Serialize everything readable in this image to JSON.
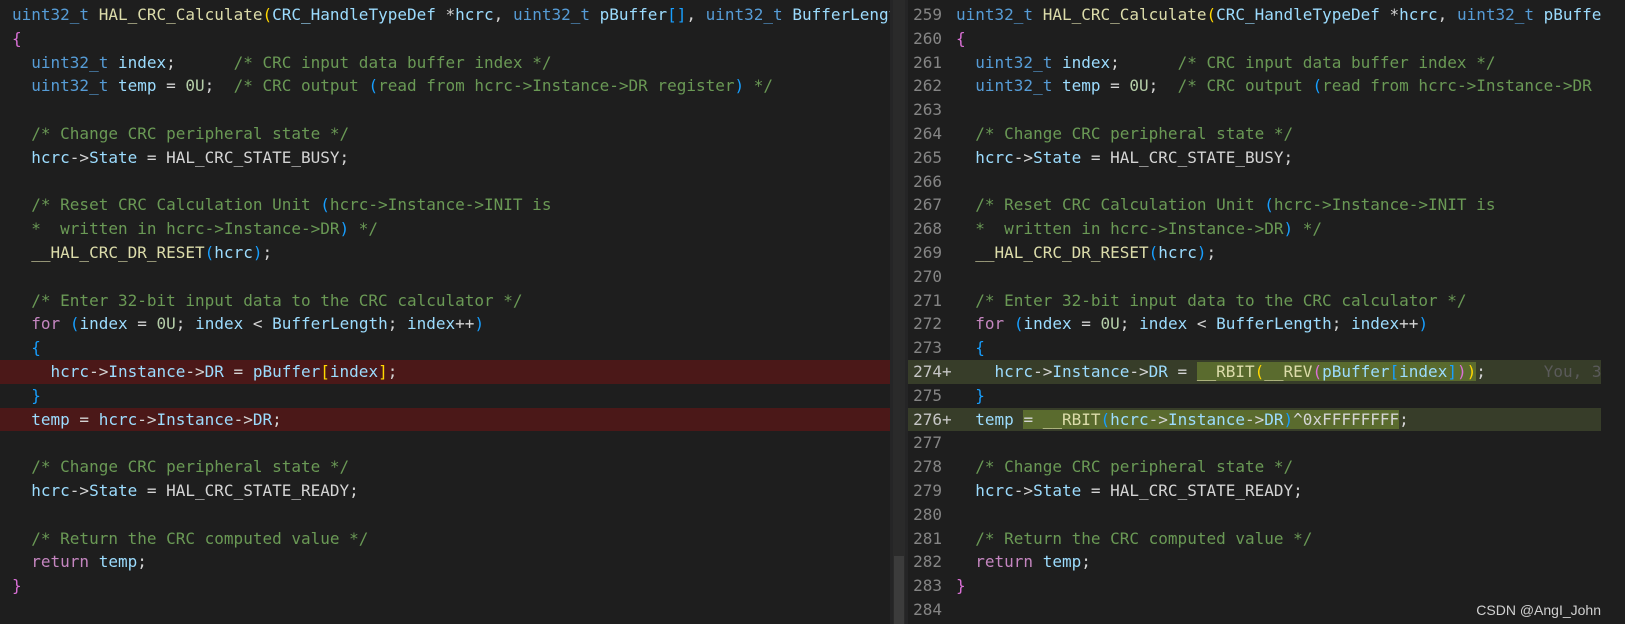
{
  "editor": {
    "watermark": "CSDN @AngI_John",
    "blame_hint": "You, 3"
  },
  "left": {
    "lines": [
      {
        "kind": "normal",
        "tokens": [
          [
            "type",
            "uint32_t"
          ],
          [
            "txt",
            " "
          ],
          [
            "fn",
            "HAL_CRC_Calculate"
          ],
          [
            "br3",
            "("
          ],
          [
            "id",
            "CRC_HandleTypeDef"
          ],
          [
            "txt",
            " *"
          ],
          [
            "id",
            "hcrc"
          ],
          [
            "txt",
            ", "
          ],
          [
            "type",
            "uint32_t"
          ],
          [
            "txt",
            " "
          ],
          [
            "id",
            "pBuffer"
          ],
          [
            "br2",
            "[]"
          ],
          [
            "txt",
            ", "
          ],
          [
            "type",
            "uint32_t"
          ],
          [
            "txt",
            " "
          ],
          [
            "id",
            "BufferLength"
          ]
        ]
      },
      {
        "kind": "normal",
        "tokens": [
          [
            "br1",
            "{"
          ]
        ]
      },
      {
        "kind": "normal",
        "tokens": [
          [
            "txt",
            "  "
          ],
          [
            "type",
            "uint32_t"
          ],
          [
            "txt",
            " "
          ],
          [
            "id",
            "index"
          ],
          [
            "txt",
            ";      "
          ],
          [
            "cm",
            "/* CRC input data buffer index */"
          ]
        ]
      },
      {
        "kind": "normal",
        "tokens": [
          [
            "txt",
            "  "
          ],
          [
            "type",
            "uint32_t"
          ],
          [
            "txt",
            " "
          ],
          [
            "id",
            "temp"
          ],
          [
            "txt",
            " = "
          ],
          [
            "num",
            "0U"
          ],
          [
            "txt",
            ";  "
          ],
          [
            "cm",
            "/* CRC output "
          ],
          [
            "br2",
            "("
          ],
          [
            "cm",
            "read from hcrc->Instance->DR register"
          ],
          [
            "br2",
            ")"
          ],
          [
            "cm",
            " */"
          ]
        ]
      },
      {
        "kind": "normal",
        "tokens": []
      },
      {
        "kind": "normal",
        "tokens": [
          [
            "txt",
            "  "
          ],
          [
            "cm",
            "/* Change CRC peripheral state */"
          ]
        ]
      },
      {
        "kind": "normal",
        "tokens": [
          [
            "txt",
            "  "
          ],
          [
            "id",
            "hcrc"
          ],
          [
            "txt",
            "->"
          ],
          [
            "id",
            "State"
          ],
          [
            "txt",
            " = HAL_CRC_STATE_BUSY;"
          ]
        ]
      },
      {
        "kind": "normal",
        "tokens": []
      },
      {
        "kind": "normal",
        "tokens": [
          [
            "txt",
            "  "
          ],
          [
            "cm",
            "/* Reset CRC Calculation Unit "
          ],
          [
            "br2",
            "("
          ],
          [
            "cm",
            "hcrc->Instance->INIT is"
          ]
        ]
      },
      {
        "kind": "normal",
        "tokens": [
          [
            "txt",
            "  "
          ],
          [
            "cm",
            "*  written in hcrc->Instance->DR"
          ],
          [
            "br2",
            ")"
          ],
          [
            "cm",
            " */"
          ]
        ]
      },
      {
        "kind": "normal",
        "tokens": [
          [
            "txt",
            "  "
          ],
          [
            "fn",
            "__HAL_CRC_DR_RESET"
          ],
          [
            "br2",
            "("
          ],
          [
            "id",
            "hcrc"
          ],
          [
            "br2",
            ")"
          ],
          [
            "txt",
            ";"
          ]
        ]
      },
      {
        "kind": "normal",
        "tokens": []
      },
      {
        "kind": "normal",
        "tokens": [
          [
            "txt",
            "  "
          ],
          [
            "cm",
            "/* Enter 32-bit input data to the CRC calculator */"
          ]
        ]
      },
      {
        "kind": "normal",
        "tokens": [
          [
            "txt",
            "  "
          ],
          [
            "kw",
            "for"
          ],
          [
            "txt",
            " "
          ],
          [
            "br2",
            "("
          ],
          [
            "id",
            "index"
          ],
          [
            "txt",
            " = "
          ],
          [
            "num",
            "0U"
          ],
          [
            "txt",
            "; "
          ],
          [
            "id",
            "index"
          ],
          [
            "txt",
            " < "
          ],
          [
            "id",
            "BufferLength"
          ],
          [
            "txt",
            "; "
          ],
          [
            "id",
            "index"
          ],
          [
            "txt",
            "++"
          ],
          [
            "br2",
            ")"
          ]
        ]
      },
      {
        "kind": "normal",
        "tokens": [
          [
            "txt",
            "  "
          ],
          [
            "br2",
            "{"
          ]
        ]
      },
      {
        "kind": "del",
        "marker": "-",
        "tokens": [
          [
            "txt",
            "    "
          ],
          [
            "id",
            "hcrc"
          ],
          [
            "txt",
            "->"
          ],
          [
            "id",
            "Instance"
          ],
          [
            "txt",
            "->"
          ],
          [
            "id",
            "DR"
          ],
          [
            "txt",
            " = "
          ],
          [
            "id",
            "pBuffer"
          ],
          [
            "br3",
            "["
          ],
          [
            "id",
            "index"
          ],
          [
            "br3",
            "]"
          ],
          [
            "txt",
            ";"
          ]
        ]
      },
      {
        "kind": "normal",
        "tokens": [
          [
            "txt",
            "  "
          ],
          [
            "br2",
            "}"
          ]
        ]
      },
      {
        "kind": "del",
        "marker": "-",
        "tokens": [
          [
            "txt",
            "  "
          ],
          [
            "id",
            "temp"
          ],
          [
            "txt",
            " = "
          ],
          [
            "id",
            "hcrc"
          ],
          [
            "txt",
            "->"
          ],
          [
            "id",
            "Instance"
          ],
          [
            "txt",
            "->"
          ],
          [
            "id",
            "DR"
          ],
          [
            "txt",
            ";"
          ]
        ]
      },
      {
        "kind": "normal",
        "tokens": []
      },
      {
        "kind": "normal",
        "tokens": [
          [
            "txt",
            "  "
          ],
          [
            "cm",
            "/* Change CRC peripheral state */"
          ]
        ]
      },
      {
        "kind": "normal",
        "tokens": [
          [
            "txt",
            "  "
          ],
          [
            "id",
            "hcrc"
          ],
          [
            "txt",
            "->"
          ],
          [
            "id",
            "State"
          ],
          [
            "txt",
            " = HAL_CRC_STATE_READY;"
          ]
        ]
      },
      {
        "kind": "normal",
        "tokens": []
      },
      {
        "kind": "normal",
        "tokens": [
          [
            "txt",
            "  "
          ],
          [
            "cm",
            "/* Return the CRC computed value */"
          ]
        ]
      },
      {
        "kind": "normal",
        "tokens": [
          [
            "txt",
            "  "
          ],
          [
            "kw",
            "return"
          ],
          [
            "txt",
            " "
          ],
          [
            "id",
            "temp"
          ],
          [
            "txt",
            ";"
          ]
        ]
      },
      {
        "kind": "normal",
        "tokens": [
          [
            "br1",
            "}"
          ]
        ]
      }
    ]
  },
  "right": {
    "lines": [
      {
        "num": "259",
        "kind": "normal",
        "tokens": [
          [
            "type",
            "uint32_t"
          ],
          [
            "txt",
            " "
          ],
          [
            "fn",
            "HAL_CRC_Calculate"
          ],
          [
            "br3",
            "("
          ],
          [
            "id",
            "CRC_HandleTypeDef"
          ],
          [
            "txt",
            " *"
          ],
          [
            "id",
            "hcrc"
          ],
          [
            "txt",
            ", "
          ],
          [
            "type",
            "uint32_t"
          ],
          [
            "txt",
            " "
          ],
          [
            "id",
            "pBuffe"
          ]
        ]
      },
      {
        "num": "260",
        "kind": "normal",
        "tokens": [
          [
            "br1",
            "{"
          ]
        ]
      },
      {
        "num": "261",
        "kind": "normal",
        "tokens": [
          [
            "txt",
            "  "
          ],
          [
            "type",
            "uint32_t"
          ],
          [
            "txt",
            " "
          ],
          [
            "id",
            "index"
          ],
          [
            "txt",
            ";      "
          ],
          [
            "cm",
            "/* CRC input data buffer index */"
          ]
        ]
      },
      {
        "num": "262",
        "kind": "normal",
        "tokens": [
          [
            "txt",
            "  "
          ],
          [
            "type",
            "uint32_t"
          ],
          [
            "txt",
            " "
          ],
          [
            "id",
            "temp"
          ],
          [
            "txt",
            " = "
          ],
          [
            "num",
            "0U"
          ],
          [
            "txt",
            ";  "
          ],
          [
            "cm",
            "/* CRC output "
          ],
          [
            "br2",
            "("
          ],
          [
            "cm",
            "read from hcrc->Instance->DR"
          ]
        ]
      },
      {
        "num": "263",
        "kind": "normal",
        "tokens": []
      },
      {
        "num": "264",
        "kind": "normal",
        "tokens": [
          [
            "txt",
            "  "
          ],
          [
            "cm",
            "/* Change CRC peripheral state */"
          ]
        ]
      },
      {
        "num": "265",
        "kind": "normal",
        "tokens": [
          [
            "txt",
            "  "
          ],
          [
            "id",
            "hcrc"
          ],
          [
            "txt",
            "->"
          ],
          [
            "id",
            "State"
          ],
          [
            "txt",
            " = HAL_CRC_STATE_BUSY;"
          ]
        ]
      },
      {
        "num": "266",
        "kind": "normal",
        "tokens": []
      },
      {
        "num": "267",
        "kind": "normal",
        "tokens": [
          [
            "txt",
            "  "
          ],
          [
            "cm",
            "/* Reset CRC Calculation Unit "
          ],
          [
            "br2",
            "("
          ],
          [
            "cm",
            "hcrc->Instance->INIT is"
          ]
        ]
      },
      {
        "num": "268",
        "kind": "normal",
        "tokens": [
          [
            "txt",
            "  "
          ],
          [
            "cm",
            "*  written in hcrc->Instance->DR"
          ],
          [
            "br2",
            ")"
          ],
          [
            "cm",
            " */"
          ]
        ]
      },
      {
        "num": "269",
        "kind": "normal",
        "tokens": [
          [
            "txt",
            "  "
          ],
          [
            "fn",
            "__HAL_CRC_DR_RESET"
          ],
          [
            "br2",
            "("
          ],
          [
            "id",
            "hcrc"
          ],
          [
            "br2",
            ")"
          ],
          [
            "txt",
            ";"
          ]
        ]
      },
      {
        "num": "270",
        "kind": "normal",
        "tokens": []
      },
      {
        "num": "271",
        "kind": "normal",
        "tokens": [
          [
            "txt",
            "  "
          ],
          [
            "cm",
            "/* Enter 32-bit input data to the CRC calculator */"
          ]
        ]
      },
      {
        "num": "272",
        "kind": "normal",
        "tokens": [
          [
            "txt",
            "  "
          ],
          [
            "kw",
            "for"
          ],
          [
            "txt",
            " "
          ],
          [
            "br2",
            "("
          ],
          [
            "id",
            "index"
          ],
          [
            "txt",
            " = "
          ],
          [
            "num",
            "0U"
          ],
          [
            "txt",
            "; "
          ],
          [
            "id",
            "index"
          ],
          [
            "txt",
            " < "
          ],
          [
            "id",
            "BufferLength"
          ],
          [
            "txt",
            "; "
          ],
          [
            "id",
            "index"
          ],
          [
            "txt",
            "++"
          ],
          [
            "br2",
            ")"
          ]
        ]
      },
      {
        "num": "273",
        "kind": "normal",
        "tokens": [
          [
            "txt",
            "  "
          ],
          [
            "br2",
            "{"
          ]
        ]
      },
      {
        "num": "274",
        "kind": "add",
        "marker": "+",
        "tokens": [
          [
            "txt",
            "    "
          ],
          [
            "id",
            "hcrc"
          ],
          [
            "txt",
            "->"
          ],
          [
            "id",
            "Instance"
          ],
          [
            "txt",
            "->"
          ],
          [
            "id",
            "DR"
          ],
          [
            "txt",
            " = "
          ],
          [
            "fnhl",
            "__RBIT"
          ],
          [
            "br3hl",
            "("
          ],
          [
            "fnhl",
            "__REV"
          ],
          [
            "br1hl",
            "("
          ],
          [
            "idhl",
            "pBuffer"
          ],
          [
            "br2hl",
            "["
          ],
          [
            "idhl",
            "index"
          ],
          [
            "br2hl",
            "]"
          ],
          [
            "br1hl",
            ")"
          ],
          [
            "br3hl",
            ")"
          ],
          [
            "txt",
            ";"
          ],
          [
            "txt",
            "      "
          ],
          [
            "blame",
            "You, 3"
          ]
        ]
      },
      {
        "num": "275",
        "kind": "normal",
        "tokens": [
          [
            "txt",
            "  "
          ],
          [
            "br2",
            "}"
          ]
        ]
      },
      {
        "num": "276",
        "kind": "add",
        "marker": "+",
        "tokens": [
          [
            "txt",
            "  "
          ],
          [
            "id",
            "temp"
          ],
          [
            "txt",
            " "
          ],
          [
            "txthl",
            "= "
          ],
          [
            "fnhl",
            "__RBIT"
          ],
          [
            "br2hl",
            "("
          ],
          [
            "idhl",
            "hcrc"
          ],
          [
            "txthl",
            "->"
          ],
          [
            "idhl",
            "Instance"
          ],
          [
            "txthl",
            "->"
          ],
          [
            "idhl",
            "DR"
          ],
          [
            "br2hl",
            ")"
          ],
          [
            "txthl",
            "^0xFFFFFFFF"
          ],
          [
            "txt",
            ";"
          ]
        ]
      },
      {
        "num": "277",
        "kind": "normal",
        "tokens": []
      },
      {
        "num": "278",
        "kind": "normal",
        "tokens": [
          [
            "txt",
            "  "
          ],
          [
            "cm",
            "/* Change CRC peripheral state */"
          ]
        ]
      },
      {
        "num": "279",
        "kind": "normal",
        "tokens": [
          [
            "txt",
            "  "
          ],
          [
            "id",
            "hcrc"
          ],
          [
            "txt",
            "->"
          ],
          [
            "id",
            "State"
          ],
          [
            "txt",
            " = HAL_CRC_STATE_READY;"
          ]
        ]
      },
      {
        "num": "280",
        "kind": "normal",
        "tokens": []
      },
      {
        "num": "281",
        "kind": "normal",
        "tokens": [
          [
            "txt",
            "  "
          ],
          [
            "cm",
            "/* Return the CRC computed value */"
          ]
        ]
      },
      {
        "num": "282",
        "kind": "normal",
        "tokens": [
          [
            "txt",
            "  "
          ],
          [
            "kw",
            "return"
          ],
          [
            "txt",
            " "
          ],
          [
            "id",
            "temp"
          ],
          [
            "txt",
            ";"
          ]
        ]
      },
      {
        "num": "283",
        "kind": "normal",
        "tokens": [
          [
            "br1",
            "}"
          ]
        ]
      },
      {
        "num": "284",
        "kind": "normal",
        "tokens": []
      }
    ]
  }
}
